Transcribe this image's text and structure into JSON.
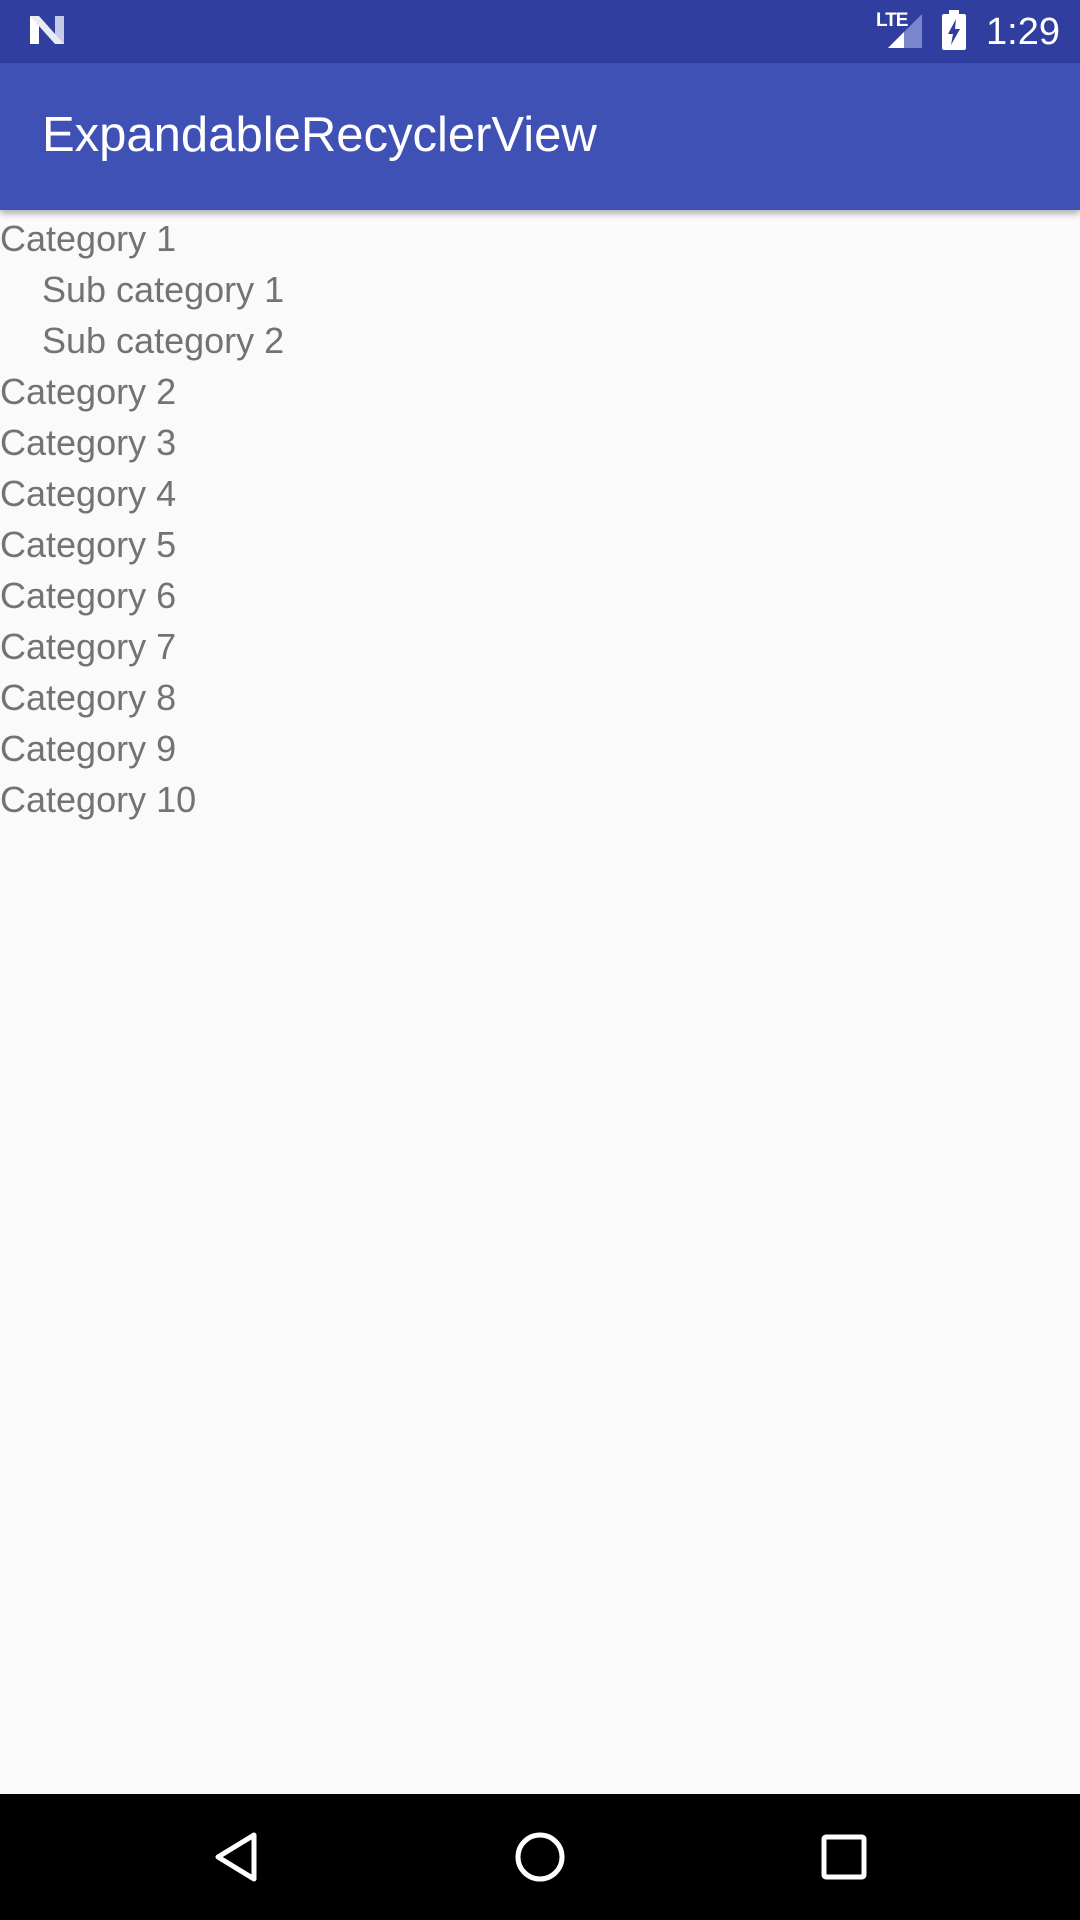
{
  "status_bar": {
    "network_label": "LTE",
    "time": "1:29",
    "icons": [
      "android-n-logo-icon",
      "signal-icon",
      "battery-charging-icon"
    ],
    "background": "#303f9f"
  },
  "app_bar": {
    "title": "ExpandableRecyclerView",
    "background": "#3f51b5"
  },
  "list": {
    "items": [
      {
        "label": "Category 1",
        "level": 0,
        "expanded": true
      },
      {
        "label": "Sub category 1",
        "level": 1
      },
      {
        "label": "Sub category 2",
        "level": 1
      },
      {
        "label": "Category 2",
        "level": 0
      },
      {
        "label": "Category 3",
        "level": 0
      },
      {
        "label": "Category 4",
        "level": 0
      },
      {
        "label": "Category 5",
        "level": 0
      },
      {
        "label": "Category 6",
        "level": 0
      },
      {
        "label": "Category 7",
        "level": 0
      },
      {
        "label": "Category 8",
        "level": 0
      },
      {
        "label": "Category 9",
        "level": 0
      },
      {
        "label": "Category 10",
        "level": 0
      }
    ],
    "text_color": "#737373"
  },
  "nav_bar": {
    "buttons": [
      "back-icon",
      "home-icon",
      "recents-icon"
    ],
    "background": "#000000"
  }
}
